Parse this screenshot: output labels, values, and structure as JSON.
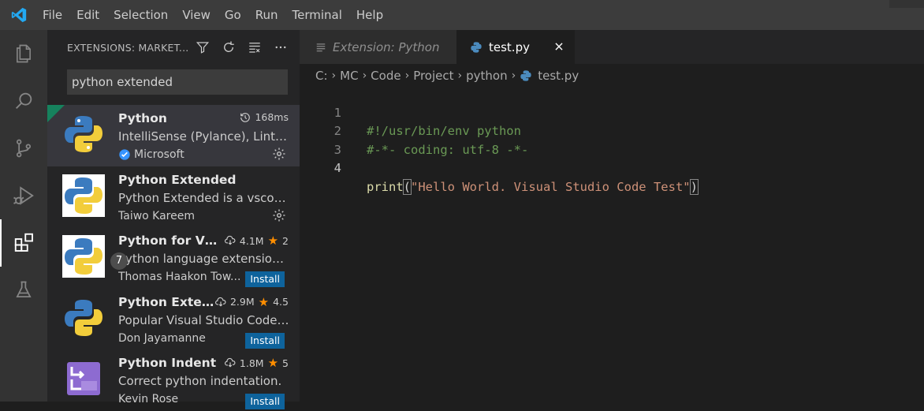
{
  "menu": [
    "File",
    "Edit",
    "Selection",
    "View",
    "Go",
    "Run",
    "Terminal",
    "Help"
  ],
  "activity_bar": [
    "explorer-icon",
    "search-icon",
    "source-control-icon",
    "run-debug-icon",
    "extensions-icon",
    "testing-icon"
  ],
  "sidebar": {
    "title": "EXTENSIONS: MARKET...",
    "search_value": "python extended",
    "extensions": [
      {
        "name": "Python",
        "meta": "168ms",
        "meta_icon": "history-icon",
        "description": "IntelliSense (Pylance), Lintin...",
        "publisher": "Microsoft",
        "verified": true,
        "action": "gear"
      },
      {
        "name": "Python Extended",
        "description": "Python Extended is a vscode...",
        "publisher": "Taiwo Kareem",
        "action": "gear"
      },
      {
        "name": "Python for VS...",
        "downloads": "4.1M",
        "rating": "2",
        "description": "Python language extension f...",
        "publisher": "Thomas Haakon Tow...",
        "action": "Install"
      },
      {
        "name": "Python Exten...",
        "downloads": "2.9M",
        "rating": "4.5",
        "description": "Popular Visual Studio Code ...",
        "publisher": "Don Jayamanne",
        "action": "Install",
        "badge": "7"
      },
      {
        "name": "Python Indent",
        "downloads": "1.8M",
        "rating": "5",
        "description": "Correct python indentation.",
        "publisher": "Kevin Rose",
        "action": "Install"
      }
    ]
  },
  "editor": {
    "tabs": [
      {
        "label": "Extension: Python",
        "active": false
      },
      {
        "label": "test.py",
        "active": true
      }
    ],
    "breadcrumbs": [
      "C:",
      "MC",
      "Code",
      "Project",
      "python",
      "test.py"
    ],
    "lines": [
      {
        "n": "1",
        "text": "#!/usr/bin/env python"
      },
      {
        "n": "2",
        "text": "#-*- coding: utf-8 -*-"
      },
      {
        "n": "3",
        "text": ""
      },
      {
        "n": "4",
        "fn": "print",
        "open": "(",
        "str": "\"Hello World. Visual Studio Code Test\"",
        "close": ")"
      }
    ]
  },
  "colors": {
    "accent": "#0e639c",
    "comment": "#6a9955",
    "string": "#ce9178",
    "function": "#dcdcaa",
    "star": "#ff8e00"
  }
}
